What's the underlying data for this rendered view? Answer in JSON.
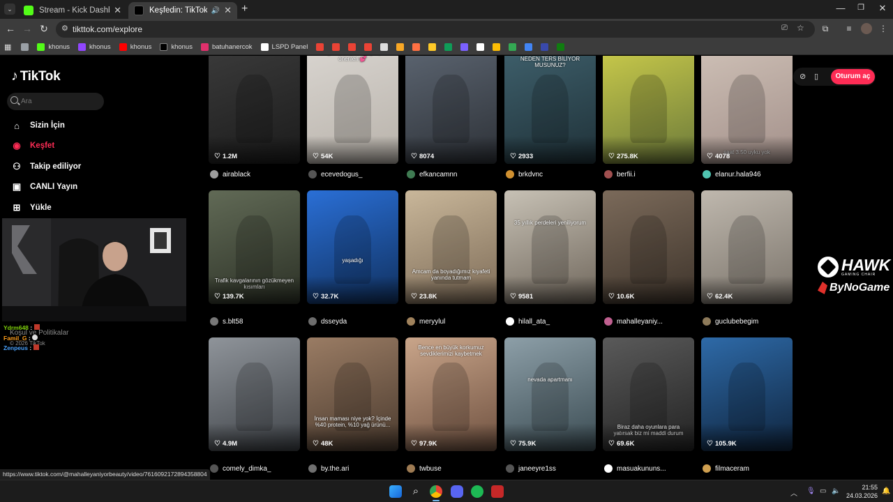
{
  "browser": {
    "tabs": [
      {
        "title": "Stream - Kick Dashboard",
        "favicon_color": "#53fc18"
      },
      {
        "title": "Keşfedin: TikTok'ta favori vi",
        "favicon_color": "#000000"
      }
    ],
    "url": "tikttok.com/explore",
    "bookmarks": [
      {
        "label": "",
        "icon": "folder-icon",
        "color": "#9aa0a6"
      },
      {
        "label": "khonus",
        "icon": "kick-icon",
        "color": "#53fc18"
      },
      {
        "label": "khonus",
        "icon": "twitch-icon",
        "color": "#9146ff"
      },
      {
        "label": "khonus",
        "icon": "youtube-icon",
        "color": "#ff0000"
      },
      {
        "label": "khonus",
        "icon": "x-icon",
        "color": "#000000"
      },
      {
        "label": "batuhanercok",
        "icon": "instagram-icon",
        "color": "#e1306c"
      },
      {
        "label": "LSPD Panel",
        "icon": "globe-icon",
        "color": "#ffffff"
      },
      {
        "label": "",
        "icon": "gmail-icon",
        "color": "#ea4335"
      },
      {
        "label": "",
        "icon": "gmail-icon",
        "color": "#ea4335"
      },
      {
        "label": "",
        "icon": "gmail-icon",
        "color": "#ea4335"
      },
      {
        "label": "",
        "icon": "gmail-icon",
        "color": "#ea4335"
      },
      {
        "label": "",
        "icon": "doc-icon",
        "color": "#dddddd"
      },
      {
        "label": "",
        "icon": "game-icon",
        "color": "#f9a825"
      },
      {
        "label": "",
        "icon": "game-icon",
        "color": "#ff7043"
      },
      {
        "label": "",
        "icon": "game-icon",
        "color": "#ffca28"
      },
      {
        "label": "",
        "icon": "sheets-icon",
        "color": "#0f9d58"
      },
      {
        "label": "",
        "icon": "list-icon",
        "color": "#7b61ff"
      },
      {
        "label": "",
        "icon": "arrow-icon",
        "color": "#ffffff"
      },
      {
        "label": "",
        "icon": "pencil-icon",
        "color": "#fbbc04"
      },
      {
        "label": "",
        "icon": "drive-icon",
        "color": "#34a853"
      },
      {
        "label": "",
        "icon": "shield-icon",
        "color": "#4285f4"
      },
      {
        "label": "",
        "icon": "globe-icon",
        "color": "#3949ab"
      },
      {
        "label": "",
        "icon": "xbox-icon",
        "color": "#107c10"
      }
    ],
    "status_url": "https://www.tiktok.com/@mahalleyaniyorbeauty/video/7616092172894358804"
  },
  "tiktok": {
    "logo": "TikTok",
    "search_placeholder": "Ara",
    "nav": [
      {
        "label": "Sizin İçin",
        "icon": "home-icon",
        "active": false
      },
      {
        "label": "Keşfet",
        "icon": "compass-icon",
        "active": true
      },
      {
        "label": "Takip ediliyor",
        "icon": "following-icon",
        "active": false
      },
      {
        "label": "CANLI Yayın",
        "icon": "live-icon",
        "active": false
      },
      {
        "label": "Yükle",
        "icon": "upload-icon",
        "active": false
      }
    ],
    "footer_link": "Koşul ve Politikalar",
    "copyright": "© 2026 TikTok",
    "login_button": "Oturum aç",
    "accent": "#fe2c55"
  },
  "chat": [
    {
      "user": "Ydrm648",
      "text": ":",
      "color": "#7fd10b"
    },
    {
      "user": "Famil_G",
      "text": ":",
      "color": "#ff9f1c"
    },
    {
      "user": "Zenpeus",
      "text": ":",
      "color": "#4aa3ff"
    }
  ],
  "overlay": {
    "brand": "HAWK",
    "brand_sub": "GAMING CHAIR",
    "sponsor": "ByNoGame"
  },
  "videos": [
    {
      "likes": "1.2M",
      "author": "airablack",
      "caption": "",
      "bg": [
        "#3a3a3a",
        "#1b1b1b"
      ],
      "avatar": "#9e9e9e"
    },
    {
      "likes": "54K",
      "author": "ecevedogus_",
      "caption": "Sevgilinle çekebileceğin poz önerileri 💕",
      "bg": [
        "#d8d4cf",
        "#b8b2aa"
      ],
      "avatar": "#555555"
    },
    {
      "likes": "8074",
      "author": "efkancamnn",
      "caption": "",
      "bg": [
        "#5b6470",
        "#2d3137"
      ],
      "avatar": "#3f7b52"
    },
    {
      "likes": "2933",
      "author": "brkdvnc",
      "caption": "OTOBÜSTEKİ KOLTUKLAR NEDEN TERS BİLİYOR MUSUNUZ?",
      "bg": [
        "#3e5f6b",
        "#1f3138"
      ],
      "avatar": "#d09030"
    },
    {
      "likes": "275.8K",
      "author": "berfii.i",
      "caption": "",
      "bg": [
        "#c8c94a",
        "#6c7a3a"
      ],
      "avatar": "#a05050"
    },
    {
      "likes": "4078",
      "author": "elanur.hala946",
      "caption": "saat 3.50 uyku yok",
      "bg": [
        "#cdbfb5",
        "#a3908a"
      ],
      "avatar": "#4fc3b0"
    },
    {
      "likes": "139.7K",
      "author": "s.blt58",
      "caption": "Trafik kavgalarının gözükmeyen kısımları",
      "bg": [
        "#616a56",
        "#2c3126"
      ],
      "avatar": "#777777"
    },
    {
      "likes": "32.7K",
      "author": "dsseyda",
      "caption": "yaşadığı",
      "bg": [
        "#2a6fd6",
        "#10305e"
      ],
      "avatar": "#6d6d6d"
    },
    {
      "likes": "23.8K",
      "author": "meryylul",
      "caption": "Amcam da boyadığımız kıyafeti yanında tutmam",
      "bg": [
        "#c9b79a",
        "#7d6b57"
      ],
      "avatar": "#a0825c"
    },
    {
      "likes": "9581",
      "author": "hilall_ata_",
      "caption": "35 yıllık perdeleri yeniliyorum",
      "bg": [
        "#c7c1b5",
        "#6f665b"
      ],
      "avatar": "#ffffff"
    },
    {
      "likes": "10.6K",
      "author": "mahalleyaniy...",
      "caption": "",
      "bg": [
        "#7b6a5a",
        "#3e342b"
      ],
      "avatar": "#c06090"
    },
    {
      "likes": "62.4K",
      "author": "guclubebegim",
      "caption": "",
      "bg": [
        "#bfb8ae",
        "#7a736a"
      ],
      "avatar": "#8d7a5a"
    },
    {
      "likes": "4.9M",
      "author": "comely_dimka_",
      "caption": "",
      "bg": [
        "#8f949a",
        "#3f4348"
      ],
      "avatar": "#555555"
    },
    {
      "likes": "48K",
      "author": "by.the.ari",
      "caption": "İnsan maması niye yok? İçinde %40 protein, %10 yağ ürünü...",
      "bg": [
        "#9a7c64",
        "#4a3a2e"
      ],
      "avatar": "#707070"
    },
    {
      "likes": "97.9K",
      "author": "twbuse",
      "caption": "Bence en büyük korkumuz sevdiklerimizi kaybetmek",
      "bg": [
        "#c9a58a",
        "#6f5140"
      ],
      "avatar": "#9e7b53"
    },
    {
      "likes": "75.9K",
      "author": "janeeyre1ss",
      "caption": "nevada apartmanı",
      "bg": [
        "#8d9fa8",
        "#3a4b52"
      ],
      "avatar": "#555555"
    },
    {
      "likes": "69.6K",
      "author": "masuakununs...",
      "caption": "Biraz daha oyunlara para yatırsak biz mi maddi durum",
      "bg": [
        "#5a5a5a",
        "#222222"
      ],
      "avatar": "#ffffff"
    },
    {
      "likes": "105.9K",
      "author": "filmaceram",
      "caption": "",
      "bg": [
        "#2e6aa8",
        "#0f243d"
      ],
      "avatar": "#d0a050"
    }
  ],
  "taskbar": {
    "time": "21:55",
    "date": "24.03.2026"
  }
}
